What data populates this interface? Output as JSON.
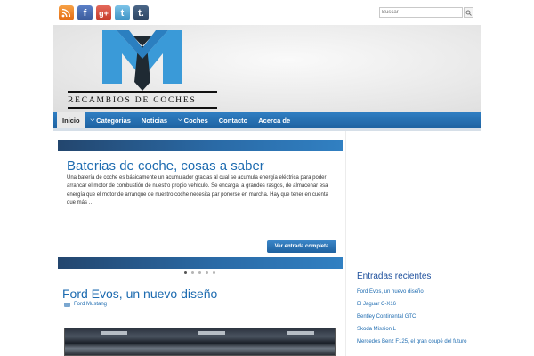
{
  "header": {
    "logo_text": "RECAMBIOS DE COCHES",
    "logo_colors": {
      "blue": "#3a9ad8",
      "dark": "#1f2a33"
    }
  },
  "social": [
    "rss-icon",
    "facebook-icon",
    "google-plus-icon",
    "twitter-icon",
    "tumblr-icon"
  ],
  "search": {
    "placeholder": "Buscar"
  },
  "nav": {
    "items": [
      {
        "label": "Inicio",
        "active": true
      },
      {
        "label": "Categorias",
        "dropdown": true
      },
      {
        "label": "Noticias"
      },
      {
        "label": "Coches",
        "dropdown": true
      },
      {
        "label": "Contacto"
      },
      {
        "label": "Acerca de"
      }
    ]
  },
  "slider": {
    "title": "Baterias de coche, cosas a saber",
    "excerpt": "Una batería de coche es básicamente un acumulador gracias al cual se acumula energía eléctrica para poder arrancar el motor de combustión de nuestro propio vehículo. Se encarga, a grandes rasgos, de almacenar esa energía que el motor de arranque de nuestro coche necesita par ponerse en marcha. Hay que tener en cuenta que más …",
    "button_label": "Ver entrada completa",
    "slide_count": 5,
    "active_slide": 1
  },
  "post": {
    "title": "Ford Evos, un nuevo diseño",
    "category": "Ford Mustang"
  },
  "sidebar": {
    "recent_title": "Entradas recientes",
    "recent": [
      "Ford Evos, un nuevo diseño",
      "El Jaguar C-X16",
      "Bentley Continental GTC",
      "Skoda Mission L",
      "Mercedes Benz F125, el gran coupé del futuro"
    ]
  },
  "colors": {
    "accent": "#1f63a2",
    "link": "#1d6bb0",
    "heading": "#1d4f9c"
  }
}
